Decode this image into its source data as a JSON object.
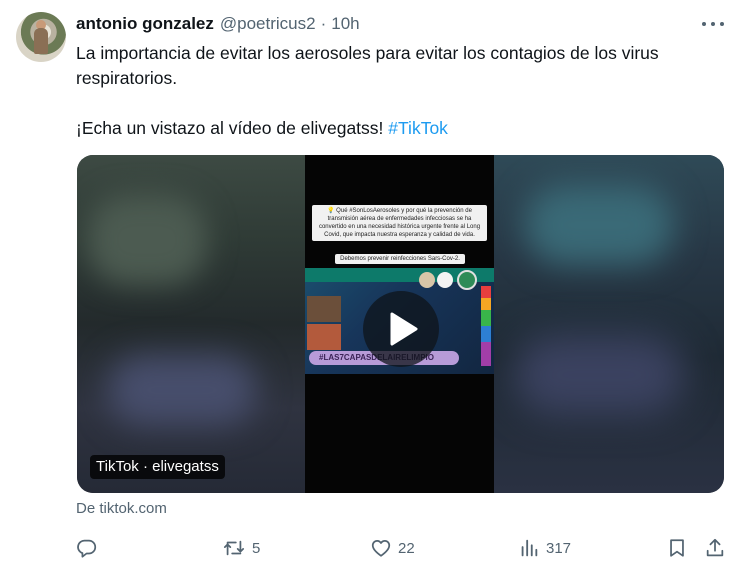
{
  "tweet": {
    "author_name": "antonio gonzalez",
    "author_handle": "@poetricus2",
    "separator": "·",
    "time": "10h",
    "text_line1": "La importancia de evitar los aerosoles para evitar los contagios de los virus respiratorios.",
    "text_line2_prefix": "¡Echa un vistazo al vídeo de elivegatss!",
    "hashtag": "#TikTok"
  },
  "card": {
    "source_label": "TikTok · elivegatss",
    "domain_text": "De tiktok.com",
    "video_caption": "💡 Qué #SonLosAerosoles y por qué la prevención de transmisión aérea de enfermedades infecciosas se ha convertido en una necesidad histórica urgente frente al Long Covid, que impacta nuestra esperanza y calidad de vida.",
    "video_caption2": "Debemos prevenir reinfecciones Sars-Cov-2.",
    "video_hashtag": "#LAS7CAPASDELAIRELIMPIO"
  },
  "actions": {
    "reply_count": "",
    "retweet_count": "5",
    "like_count": "22",
    "views_count": "317"
  },
  "icons": {
    "reply": "reply-bubble-icon",
    "retweet": "retweet-icon",
    "like": "heart-icon",
    "views": "views-bar-chart-icon",
    "bookmark": "bookmark-icon",
    "share": "share-upload-icon",
    "more": "more-dots-icon",
    "play": "play-icon"
  },
  "colors": {
    "text_primary": "#0f1419",
    "text_secondary": "#536471",
    "link": "#1d9bf0"
  }
}
